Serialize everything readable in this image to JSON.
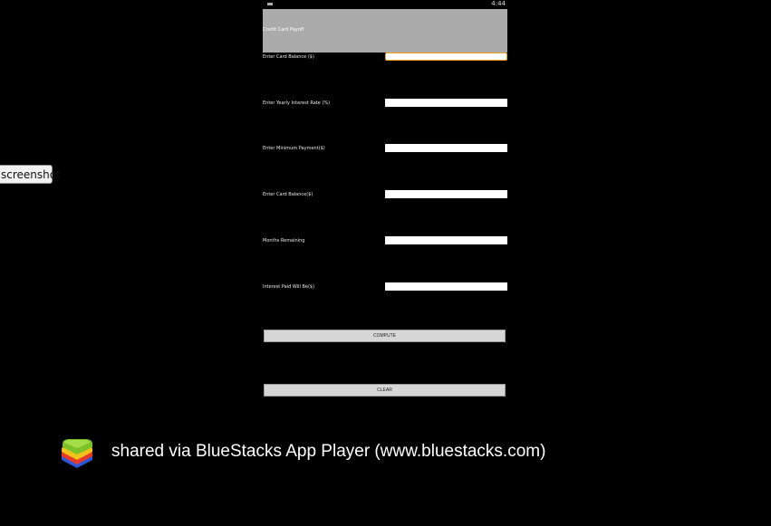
{
  "overlay": {
    "screenshot_tab_label": "screenshot"
  },
  "status_bar": {
    "clock": "4:44"
  },
  "app": {
    "title": "Credit Card Payoff",
    "fields": [
      {
        "label": "Enter Card Balance ($)",
        "value": ""
      },
      {
        "label": "Enter Yearly Interest Rate (%)",
        "value": ""
      },
      {
        "label": "Enter Minimum Payment($)",
        "value": ""
      },
      {
        "label": "Enter Card Balance($)",
        "value": ""
      },
      {
        "label": "Months Remaining",
        "value": ""
      },
      {
        "label": "Interest Paid Will Be($)",
        "value": ""
      }
    ],
    "compute_label": "COMPUTE",
    "clear_label": "CLEAR"
  },
  "watermark": {
    "text": "shared via BlueStacks App Player (www.bluestacks.com)"
  },
  "colors": {
    "title_bar": "#ababab",
    "focus_border": "#f0a020",
    "button": "#d6d6d6"
  }
}
